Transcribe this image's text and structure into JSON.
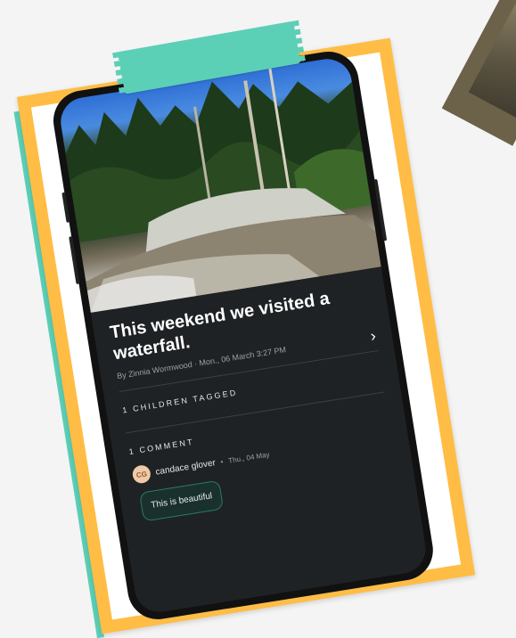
{
  "post": {
    "title": "This weekend we visited a waterfall.",
    "author_line": "By Zinnia Wormwood",
    "date": "Mon., 06 March 3:27 PM",
    "children_tagged_label": "1 CHILDREN TAGGED",
    "comments_label": "1 COMMENT"
  },
  "comments": [
    {
      "initials": "CG",
      "name": "candace glover",
      "date": "Thu., 04 May",
      "text": "This is beautiful"
    }
  ],
  "icons": {
    "detail": "chevron-right-icon"
  },
  "colors": {
    "frame": "#ffbd45",
    "tape": "#5ccfb7",
    "screen": "#1f2224",
    "comment_border": "#2a7a67"
  }
}
